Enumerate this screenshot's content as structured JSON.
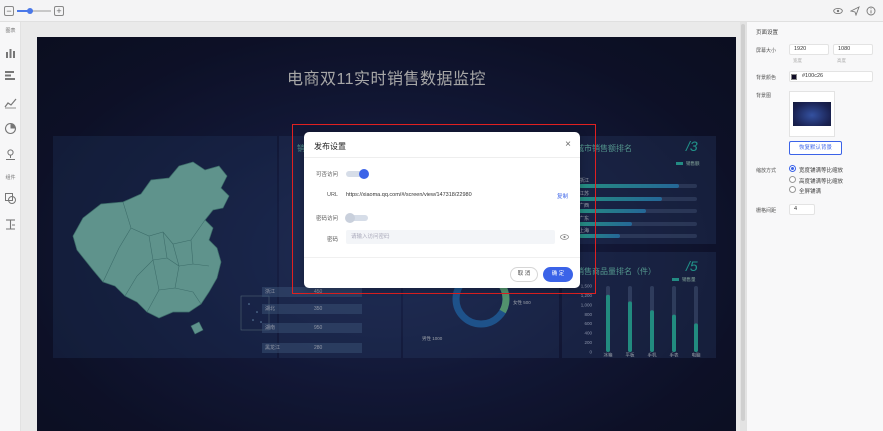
{
  "editor": {
    "sidebar": {
      "chart_section": "图表",
      "component_section": "组件"
    },
    "right_panel": {
      "title": "页面设置",
      "screen_size_label": "屏幕大小",
      "width_value": "1920",
      "height_value": "1080",
      "width_caption": "宽度",
      "height_caption": "高度",
      "bg_color_label": "背景颜色",
      "bg_color_value": "#100c26",
      "bg_image_label": "背景图",
      "restore_bg_button": "恢复默认背景",
      "scale_mode_label": "缩放方式",
      "scale_options": [
        "宽度铺满等比缩放",
        "高度铺满等比缩放",
        "全屏铺满"
      ],
      "scale_selected": "宽度铺满等比缩放",
      "grid_spacing_label": "栅格间距",
      "grid_spacing_value": "4"
    },
    "colors": {
      "accent": "#3b63e8",
      "dialog_highlight": "#e02020"
    }
  },
  "dashboard": {
    "title": "电商双11实时销售数据监控",
    "province_panel": {
      "title_fragment": "销",
      "rows": [
        {
          "name": "浙江",
          "value": "450"
        },
        {
          "name": "湖北",
          "value": "350"
        },
        {
          "name": "湖南",
          "value": "950"
        },
        {
          "name": "黑龙江",
          "value": "280"
        }
      ]
    },
    "rank_panel": {
      "title": "城市销售额排名",
      "big_number": "/3",
      "legend": "销售额"
    },
    "sales_panel": {
      "title": "销售商品量排名（件）",
      "big_number": "/5",
      "legend": "销售量"
    },
    "donut_legend": {
      "female": "女性 500",
      "male": "男性 1000"
    },
    "chart_data": [
      {
        "type": "bar",
        "orientation": "horizontal",
        "title": "城市销售额排名",
        "categories": [
          "浙江",
          "江苏",
          "广西",
          "广东",
          "上海"
        ],
        "values": [
          0.85,
          0.7,
          0.57,
          0.45,
          0.35
        ],
        "series": [
          {
            "name": "销售额",
            "values": [
              0.85,
              0.7,
              0.57,
              0.45,
              0.35
            ]
          }
        ]
      },
      {
        "type": "bar",
        "title": "销售商品量排名（件）",
        "categories": [
          "冰箱",
          "平板",
          "手机",
          "手表",
          "电脑"
        ],
        "values": [
          1300,
          1150,
          950,
          850,
          650
        ],
        "yticks": [
          "1,500",
          "1,200",
          "1,000",
          "800",
          "600",
          "400",
          "200",
          "0"
        ],
        "ylim": [
          0,
          1500
        ],
        "series": [
          {
            "name": "销售量",
            "values": [
              1300,
              1150,
              950,
              850,
              650
            ]
          }
        ]
      },
      {
        "type": "pie",
        "style": "donut",
        "categories": [
          "女性",
          "男性"
        ],
        "values": [
          500,
          1000
        ]
      }
    ]
  },
  "dialog": {
    "title": "发布设置",
    "public_access_label": "可否访问",
    "public_access_on": true,
    "url_label": "URL",
    "url_value": "https://xiaoma.qq.com/#/screen/view/147318/22980",
    "copy_label": "复制",
    "password_access_label": "密码访问",
    "password_access_on": false,
    "password_label": "密码",
    "password_placeholder": "请输入访问密码",
    "cancel_button": "取 消",
    "confirm_button": "确 定"
  }
}
